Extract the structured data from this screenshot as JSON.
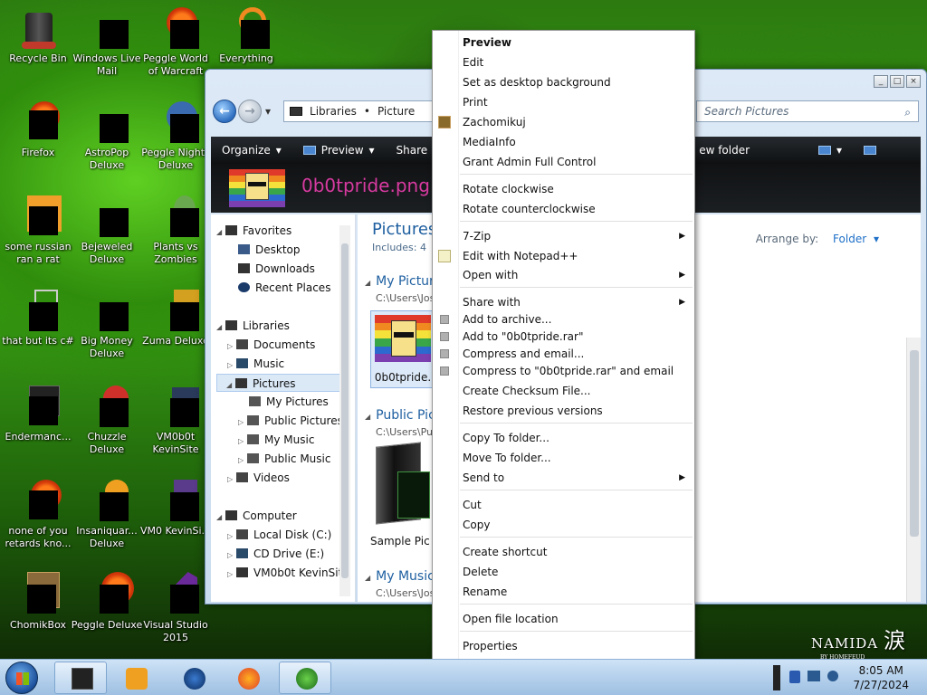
{
  "desktop": {
    "icons": [
      {
        "label": "Recycle Bin"
      },
      {
        "label": "Windows Live Mail"
      },
      {
        "label": "Peggle World of Warcraft"
      },
      {
        "label": "Everything"
      },
      {
        "label": "Firefox"
      },
      {
        "label": "AstroPop Deluxe"
      },
      {
        "label": "Peggle Nights Deluxe"
      },
      {
        "label": "some russian ran a rat"
      },
      {
        "label": "Bejeweled Deluxe"
      },
      {
        "label": "Plants vs Zombies"
      },
      {
        "label": "that but its c#"
      },
      {
        "label": "Big Money Deluxe"
      },
      {
        "label": "Zuma Deluxe"
      },
      {
        "label": "Endermanc..."
      },
      {
        "label": "Chuzzle Deluxe"
      },
      {
        "label": "VM0b0t KevinSite"
      },
      {
        "label": "none of you retards kno..."
      },
      {
        "label": "Insaniquar... Deluxe"
      },
      {
        "label": "VM0 KevinSi..."
      },
      {
        "label": "ChomikBox"
      },
      {
        "label": "Peggle Deluxe"
      },
      {
        "label": "Visual Studio 2015"
      }
    ],
    "watermark": "NAMIDA",
    "watermark_sub": "BY HOMEFEUD"
  },
  "explorer": {
    "crumbs": [
      "Libraries",
      "Picture"
    ],
    "search_placeholder": "Search Pictures",
    "toolbar": {
      "organize": "Organize",
      "preview": "Preview",
      "share": "Share",
      "new_folder": "ew folder"
    },
    "filename_header": "0b0tpride.png",
    "nav": {
      "favorites": "Favorites",
      "desktop": "Desktop",
      "downloads": "Downloads",
      "recent": "Recent Places",
      "libraries": "Libraries",
      "documents": "Documents",
      "music": "Music",
      "pictures": "Pictures",
      "my_pictures": "My Pictures",
      "public_pictures": "Public Pictures",
      "my_music": "My Music",
      "public_music": "Public Music",
      "videos": "Videos",
      "computer": "Computer",
      "local_disk": "Local Disk (C:)",
      "cd_drive": "CD Drive (E:)",
      "vm": "VM0b0t KevinSite"
    },
    "content": {
      "title": "Pictures",
      "includes": "Includes: 4",
      "arrange_label": "Arrange by:",
      "arrange_value": "Folder",
      "group1_title": "My Pictur",
      "group1_path": "C:\\Users\\Jos",
      "file1_label": "0b0tpride.",
      "group2_title": "Public Pic",
      "group2_path": "C:\\Users\\Pu",
      "folder_label": "Sample Pic",
      "group3_title": "My Music",
      "group3_path": "C:\\Users\\Jos"
    }
  },
  "context_menu": {
    "items": [
      {
        "label": "Preview"
      },
      {
        "label": "Edit"
      },
      {
        "label": "Set as desktop background"
      },
      {
        "label": "Print"
      },
      {
        "label": "Zachomikuj"
      },
      {
        "label": "MediaInfo"
      },
      {
        "label": "Grant Admin Full Control"
      },
      {
        "label": "Rotate clockwise"
      },
      {
        "label": "Rotate counterclockwise"
      },
      {
        "label": "7-Zip"
      },
      {
        "label": "Edit with Notepad++"
      },
      {
        "label": "Open with"
      },
      {
        "label": "Share with"
      },
      {
        "label": "Add to archive..."
      },
      {
        "label": "Add to \"0b0tpride.rar\""
      },
      {
        "label": "Compress and email..."
      },
      {
        "label": "Compress to \"0b0tpride.rar\" and email"
      },
      {
        "label": "Create Checksum File..."
      },
      {
        "label": "Restore previous versions"
      },
      {
        "label": "Copy To folder..."
      },
      {
        "label": "Move To folder..."
      },
      {
        "label": "Send to"
      },
      {
        "label": "Cut"
      },
      {
        "label": "Copy"
      },
      {
        "label": "Create shortcut"
      },
      {
        "label": "Delete"
      },
      {
        "label": "Rename"
      },
      {
        "label": "Open file location"
      },
      {
        "label": "Properties"
      }
    ],
    "submenu_glyph": "▶"
  },
  "taskbar": {
    "time": "8:05 AM",
    "date": "7/27/2024"
  },
  "icons": {
    "back": "←",
    "forward": "→",
    "search": "⌕",
    "expand": "▷",
    "collapse": "◢",
    "dropdown": "▾"
  }
}
